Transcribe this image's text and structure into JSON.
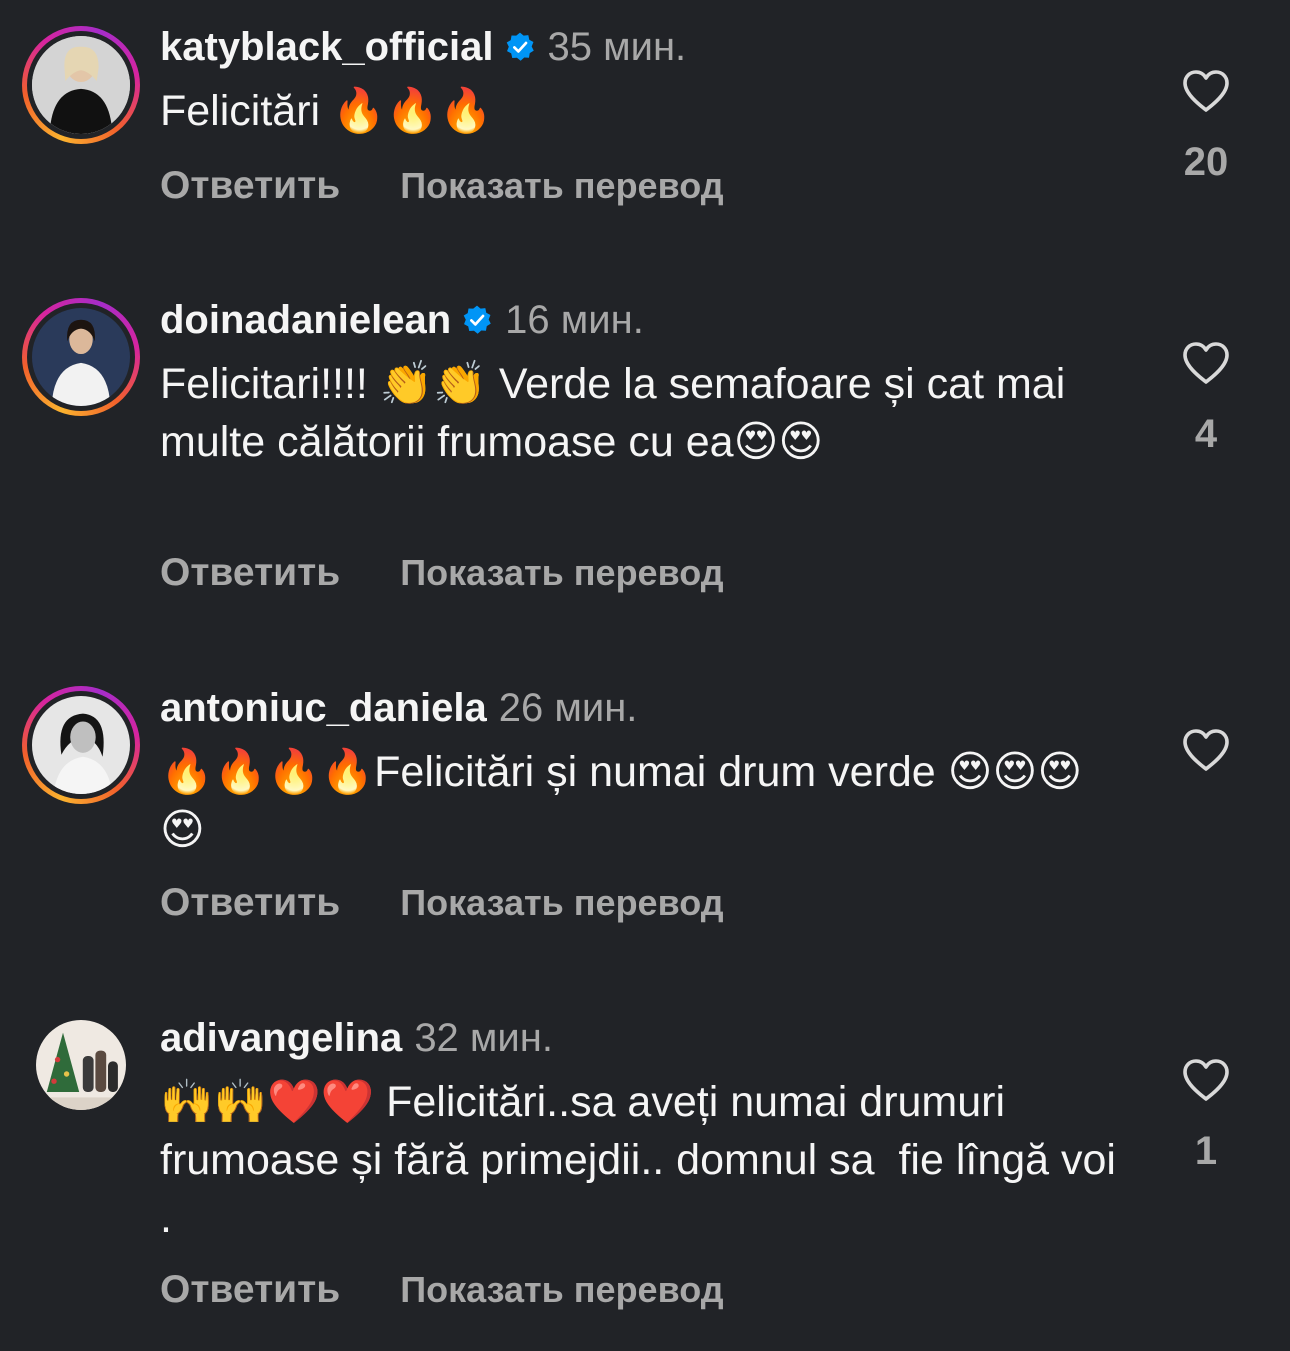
{
  "colors": {
    "background": "#212327",
    "text_primary": "#f5f5f5",
    "text_secondary": "#a8a8a8",
    "verified_blue": "#0095f6",
    "story_ring": [
      "#fbb32f",
      "#f2602c",
      "#d6249f",
      "#a52dc9"
    ]
  },
  "icons": {
    "verified": "verified-badge-icon",
    "like": "heart-outline-icon"
  },
  "comments": [
    {
      "username": "katyblack_official",
      "verified": true,
      "story_ring": true,
      "time": "35 мин.",
      "text": "Felicitări 🔥🔥🔥",
      "likes": "20",
      "reply_label": "Ответить",
      "translate_label": "Показать перевод"
    },
    {
      "username": "doinadanielean",
      "verified": true,
      "story_ring": true,
      "time": "16 мин.",
      "text": "Felicitari!!!! 👏👏 Verde la semafoare și cat mai multe călătorii frumoase cu ea😍😍",
      "likes": "4",
      "reply_label": "Ответить",
      "translate_label": "Показать перевод"
    },
    {
      "username": "antoniuc_daniela",
      "verified": false,
      "story_ring": true,
      "time": "26 мин.",
      "text": "🔥🔥🔥🔥Felicitări și numai drum verde 😍😍😍😍",
      "likes": "",
      "reply_label": "Ответить",
      "translate_label": "Показать перевод"
    },
    {
      "username": "adivangelina",
      "verified": false,
      "story_ring": false,
      "time": "32 мин.",
      "text": "🙌🙌❤️❤️ Felicitări..sa aveți numai drumuri frumoase și fără primejdii.. domnul sa  fie lîngă voi .",
      "likes": "1",
      "reply_label": "Ответить",
      "translate_label": "Показать перевод"
    }
  ]
}
